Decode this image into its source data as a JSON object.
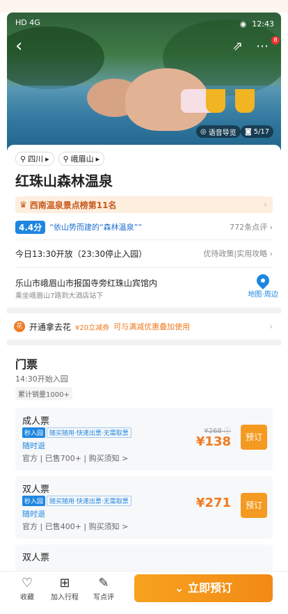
{
  "status": {
    "left": "HD 4G",
    "right": "12:43"
  },
  "hero": {
    "audio_label": "语音导览",
    "photo_count": "5/17",
    "notif_count": "8"
  },
  "location": {
    "province": "四川",
    "city": "峨眉山"
  },
  "title": "红珠山森林温泉",
  "rank": "西南温泉景点榜第11名",
  "rating": {
    "score": "4.4分",
    "quote": "“依山势而建的“森林温泉””",
    "reviews": "772条点评"
  },
  "hours": {
    "text": "今日13:30开放（23:30停止入园）",
    "policy": "优待政策|实用攻略"
  },
  "address": {
    "line1": "乐山市峨眉山市报国寺旁红珠山宾馆内",
    "line2": "乘坐峨眉山7路到大酒店站下",
    "map_label": "地图·周边"
  },
  "promo": {
    "name": "开通拿去花",
    "tag": "¥20立减券",
    "desc": "可与满减优惠叠加使用"
  },
  "tickets": {
    "title": "门票",
    "entry": "14:30开始入园",
    "sold": "累计销量1000+",
    "items": [
      {
        "name": "成人票",
        "tag1": "秒入园",
        "tag2": "随买随用·快速出票·无需取票",
        "refund": "随时退",
        "meta": "官方 | 已售700+ | 购买须知 >",
        "orig": "¥268",
        "price": "¥138",
        "btn": "预订"
      },
      {
        "name": "双人票",
        "tag1": "秒入园",
        "tag2": "随买随用·快速出票·无需取票",
        "refund": "随时退",
        "meta": "官方 | 已售400+ | 购买须知 >",
        "orig": "",
        "price": "¥271",
        "btn": "预订"
      },
      {
        "name": "双人票"
      }
    ]
  },
  "bottom": {
    "fav": "收藏",
    "itinerary": "加入行程",
    "review": "写点评",
    "cta": "立即预订"
  },
  "colors": {
    "accent": "#f07a21",
    "blue": "#1e86e0"
  }
}
